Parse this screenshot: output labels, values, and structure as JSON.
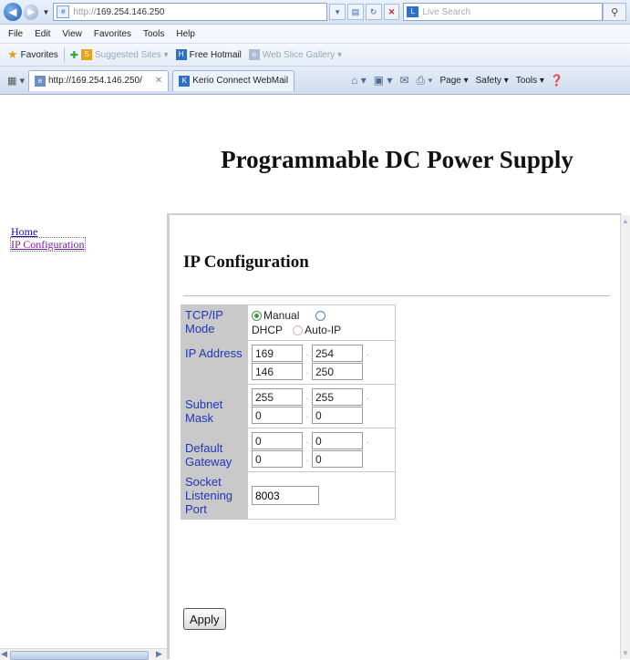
{
  "browser": {
    "address_prefix": "http://",
    "address_host": "169.254.146.250",
    "search_placeholder": "Live Search",
    "menu": [
      "File",
      "Edit",
      "View",
      "Favorites",
      "Tools",
      "Help"
    ],
    "favorites_label": "Favorites",
    "fav_links": [
      "Suggested Sites ▾",
      "Free Hotmail",
      "Web Slice Gallery ▾"
    ],
    "tabs": [
      {
        "label": "http://169.254.146.250/",
        "active": true
      },
      {
        "label": "Kerio Connect WebMail",
        "active": false
      }
    ],
    "commands": [
      "Page ▾",
      "Safety ▾",
      "Tools ▾"
    ]
  },
  "page": {
    "title": "Programmable DC Power Supply",
    "nav": [
      "Home",
      "IP Configuration"
    ],
    "section_title": "IP Configuration",
    "tcpip": {
      "label": "TCP/IP Mode",
      "options": [
        "Manual",
        "DHCP",
        "Auto-IP"
      ],
      "selected": "Manual"
    },
    "ip_address": {
      "label": "IP Address",
      "octets": [
        "169",
        "254",
        "146",
        "250"
      ]
    },
    "subnet_mask": {
      "label": "Subnet Mask",
      "octets": [
        "255",
        "255",
        "0",
        "0"
      ]
    },
    "gateway": {
      "label": "Default Gateway",
      "octets": [
        "0",
        "0",
        "0",
        "0"
      ]
    },
    "port": {
      "label": "Socket Listening Port",
      "value": "8003"
    },
    "apply_label": "Apply"
  }
}
